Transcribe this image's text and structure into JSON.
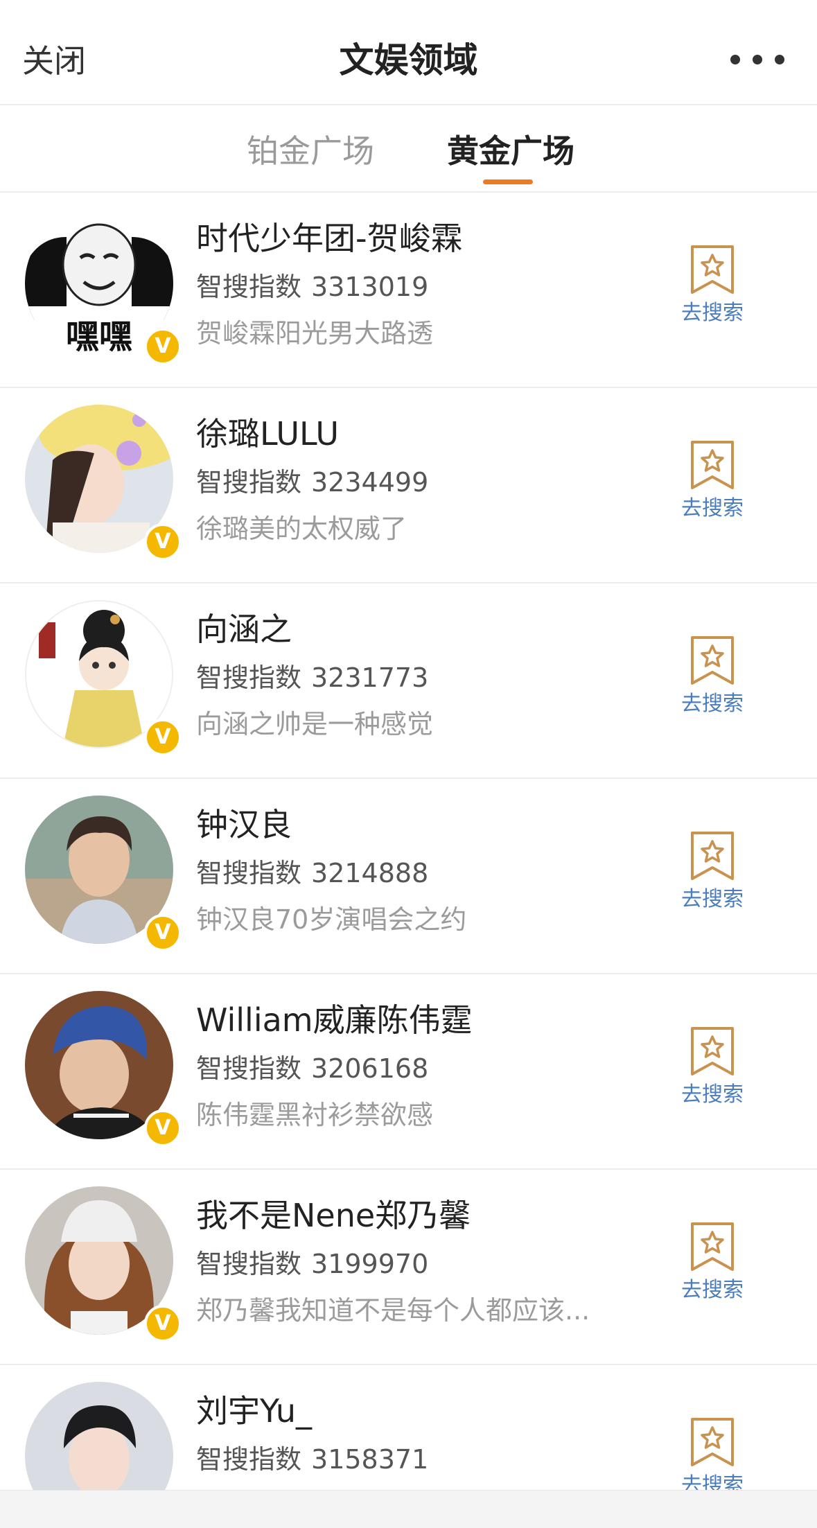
{
  "header": {
    "close_label": "关闭",
    "title": "文娱领域",
    "more_icon": "more-horizontal-icon"
  },
  "tabs": [
    {
      "label": "铂金广场",
      "active": false
    },
    {
      "label": "黄金广场",
      "active": true
    }
  ],
  "colors": {
    "accent": "#f07a1f",
    "verified_badge": "#f5b800",
    "link_blue": "#4a7dbd",
    "search_icon_gold": "#c9924f"
  },
  "index_label": "智搜指数",
  "search_label": "去搜索",
  "verified_badge_text": "V",
  "items": [
    {
      "name": "时代少年团-贺峻霖",
      "index": "3313019",
      "desc": "贺峻霖阳光男大路透",
      "avatar_text": "嘿嘿"
    },
    {
      "name": "徐璐LULU",
      "index": "3234499",
      "desc": "徐璐美的太权威了"
    },
    {
      "name": "向涵之",
      "index": "3231773",
      "desc": "向涵之帅是一种感觉"
    },
    {
      "name": "钟汉良",
      "index": "3214888",
      "desc": "钟汉良70岁演唱会之约"
    },
    {
      "name": "William威廉陈伟霆",
      "index": "3206168",
      "desc": "陈伟霆黑衬衫禁欲感"
    },
    {
      "name": "我不是Nene郑乃馨",
      "index": "3199970",
      "desc": "郑乃馨我知道不是每个人都应该..."
    },
    {
      "name": "刘宇Yu_",
      "index": "3158371",
      "desc": ""
    }
  ]
}
